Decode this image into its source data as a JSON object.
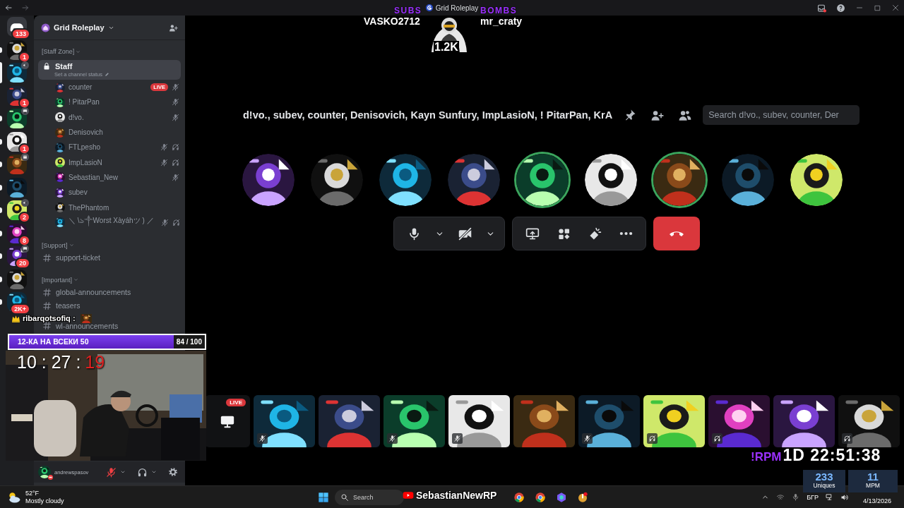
{
  "window": {
    "title": "Grid Roleplay"
  },
  "servers": [
    {
      "kind": "home",
      "badge": "133",
      "unread": false,
      "selected": false
    },
    {
      "kind": "server",
      "badge": "1",
      "unread": true,
      "selected": false
    },
    {
      "kind": "server",
      "in_voice": true,
      "unread": false,
      "selected": true
    },
    {
      "kind": "server",
      "badge": "1",
      "unread": false,
      "selected": false
    },
    {
      "kind": "server",
      "streaming": true,
      "unread": true,
      "selected": false
    },
    {
      "kind": "server",
      "badge": "1",
      "unread": true,
      "selected": false
    },
    {
      "kind": "server",
      "event": true,
      "unread": true,
      "selected": false
    },
    {
      "kind": "server",
      "unread": true,
      "selected": false
    },
    {
      "kind": "server",
      "badge": "2",
      "in_voice": true,
      "unread": true,
      "selected": false
    },
    {
      "kind": "server",
      "badge": "8",
      "unread": true,
      "selected": false
    },
    {
      "kind": "server",
      "badge": "20",
      "streaming": true,
      "unread": true,
      "selected": false
    },
    {
      "kind": "server",
      "unread": true,
      "selected": false
    },
    {
      "kind": "server",
      "badge": "2K+",
      "unread": true,
      "selected": false
    }
  ],
  "guild": {
    "name": "Grid Roleplay"
  },
  "categories": [
    {
      "name": "[Staff Zone]",
      "channels": [
        {
          "kind": "voice",
          "name": "Staff",
          "status_placeholder": "Set a channel status",
          "selected": true,
          "members": [
            {
              "name": "counter",
              "muted": true,
              "deafened": false,
              "badge": "LIVE"
            },
            {
              "name": "! PitarPan",
              "muted": true,
              "deafened": false
            },
            {
              "name": "d!vo.",
              "muted": true,
              "deafened": false
            },
            {
              "name": "Denisovich",
              "muted": false,
              "deafened": false
            },
            {
              "name": "FTLpesho",
              "muted": true,
              "deafened": true
            },
            {
              "name": "ImpLasioN",
              "muted": true,
              "deafened": true
            },
            {
              "name": "Sebastian_New",
              "muted": true,
              "deafened": false
            },
            {
              "name": "subev",
              "muted": false,
              "deafened": false
            },
            {
              "name": "ThePhantom",
              "muted": false,
              "deafened": false
            },
            {
              "name": "＼ \\ঌ༒Worst Xàyáhツ ) ／",
              "muted": true,
              "deafened": true
            }
          ]
        }
      ]
    },
    {
      "name": "[Support]",
      "channels": [
        {
          "kind": "text",
          "name": "support-ticket",
          "selected": false
        }
      ]
    },
    {
      "name": "[Important]",
      "channels": [
        {
          "kind": "text",
          "name": "global-announcements",
          "selected": false
        },
        {
          "kind": "text",
          "name": "teasers",
          "selected": false
        },
        {
          "kind": "text",
          "name": "wl-announcements",
          "selected": false
        }
      ]
    }
  ],
  "user": {
    "name": "andrewspasov",
    "muted": true
  },
  "call": {
    "participants_title": "d!vo., subev, counter, Denisovich, Kayn Sunfury, ImpLasioN, ! PitarPan, KrA",
    "search": {
      "placeholder": "Search d!vo., subev, counter, Der"
    },
    "speakers": [
      {
        "speaking": false
      },
      {
        "speaking": false
      },
      {
        "speaking": false
      },
      {
        "speaking": false
      },
      {
        "speaking": true
      },
      {
        "speaking": false
      },
      {
        "speaking": true
      },
      {
        "speaking": false
      },
      {
        "speaking": false
      }
    ],
    "controls": {
      "mic_muted": false,
      "camera_off": true
    },
    "tiles": [
      {
        "kind": "screen",
        "badge": "LIVE",
        "muted": false,
        "deafened": false
      },
      {
        "kind": "user",
        "muted": true,
        "deafened": false
      },
      {
        "kind": "user",
        "muted": false,
        "deafened": false
      },
      {
        "kind": "user",
        "muted": true,
        "deafened": false
      },
      {
        "kind": "user",
        "muted": true,
        "deafened": false
      },
      {
        "kind": "user",
        "muted": false,
        "deafened": false
      },
      {
        "kind": "user",
        "muted": true,
        "deafened": false
      },
      {
        "kind": "user",
        "muted": false,
        "deafened": true
      },
      {
        "kind": "user",
        "muted": false,
        "deafened": true
      },
      {
        "kind": "user",
        "muted": false,
        "deafened": false
      },
      {
        "kind": "user",
        "muted": false,
        "deafened": true
      }
    ]
  },
  "stream_overlay": {
    "subs_label": "SUBS",
    "subs_name": "VASKO2712",
    "bombs_label": "BOMBS",
    "bombs_name": "mr_craty",
    "count": "1.2K",
    "chat": {
      "user": "ribarqotsofiq :"
    },
    "goal": {
      "title": "12-КА НА ВСЕКИ 50",
      "reading": "84 / 100",
      "level": 0.84
    },
    "clock": {
      "time": "10 : 27 :",
      "seconds": "19"
    },
    "timer": {
      "prefix": "!RPM",
      "text": "1D 22:51:38"
    },
    "stats": [
      {
        "value": "233",
        "label": "Uniques"
      },
      {
        "value": "11",
        "label": "MPM"
      }
    ],
    "banner": "SebastianNewRP"
  },
  "taskbar": {
    "weather": {
      "temp": "52°F",
      "condition": "Mostly cloudy"
    },
    "search": {
      "placeholder": "Search"
    },
    "language": "БГР",
    "date": "4/13/2026"
  }
}
